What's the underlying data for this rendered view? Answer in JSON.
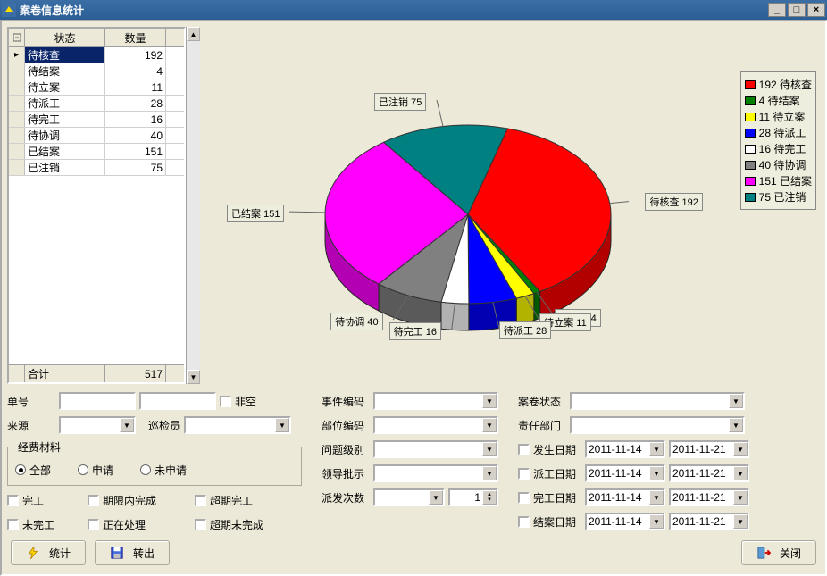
{
  "window": {
    "title": "案卷信息统计"
  },
  "grid": {
    "headers": {
      "status": "状态",
      "count": "数量"
    },
    "rows": [
      {
        "status": "待核查",
        "count": 192,
        "selected": true
      },
      {
        "status": "待结案",
        "count": 4
      },
      {
        "status": "待立案",
        "count": 11
      },
      {
        "status": "待派工",
        "count": 28
      },
      {
        "status": "待完工",
        "count": 16
      },
      {
        "status": "待协调",
        "count": 40
      },
      {
        "status": "已结案",
        "count": 151
      },
      {
        "status": "已注销",
        "count": 75
      }
    ],
    "footer": {
      "label": "合计",
      "total": 517
    }
  },
  "chart_data": {
    "type": "pie",
    "title": "",
    "categories": [
      "待核查",
      "待结案",
      "待立案",
      "待派工",
      "待完工",
      "待协调",
      "已结案",
      "已注销"
    ],
    "values": [
      192,
      4,
      11,
      28,
      16,
      40,
      151,
      75
    ],
    "colors": [
      "#ff0000",
      "#008000",
      "#ffff00",
      "#0000ff",
      "#ffffff",
      "#808080",
      "#ff00ff",
      "#008080"
    ],
    "slice_labels": [
      "待核查 192",
      "待结案 4",
      "待立案 11",
      "待派工 28",
      "待完工 16",
      "待协调 40",
      "已结案 151",
      "已注销 75"
    ],
    "legend_labels": [
      "192 待核查",
      "4 待结案",
      "11 待立案",
      "28 待派工",
      "16 待完工",
      "40 待协调",
      "151 已结案",
      "75 已注销"
    ]
  },
  "form": {
    "labels": {
      "dan_hao": "单号",
      "fei_kong": "非空",
      "lai_yuan": "来源",
      "xun_jian_yuan": "巡检员",
      "jingfei_group": "经费材料",
      "quanbu": "全部",
      "shenqing": "申请",
      "weishenqing": "未申请",
      "wangong": "完工",
      "qixiannei": "期限内完成",
      "chaoqi_wg": "超期完工",
      "weiwangong": "未完工",
      "zhengzai": "正在处理",
      "chaoqi_wwc": "超期未完成",
      "shijian_bm": "事件编码",
      "buwei_bm": "部位编码",
      "wenti_jb": "问题级别",
      "lingdao_ps": "领导批示",
      "paifa_cs": "派发次数",
      "anjuan_zt": "案卷状态",
      "zeren_bm": "责任部门",
      "fasheng_rq": "发生日期",
      "paigong_rq": "派工日期",
      "wangong_rq": "完工日期",
      "jiean_rq": "结案日期"
    },
    "values": {
      "paifa_count": "1",
      "date_from": "2011-11-14",
      "date_to": "2011-11-21"
    }
  },
  "buttons": {
    "tongji": "统计",
    "zhuanchu": "转出",
    "guanbi": "关闭"
  }
}
